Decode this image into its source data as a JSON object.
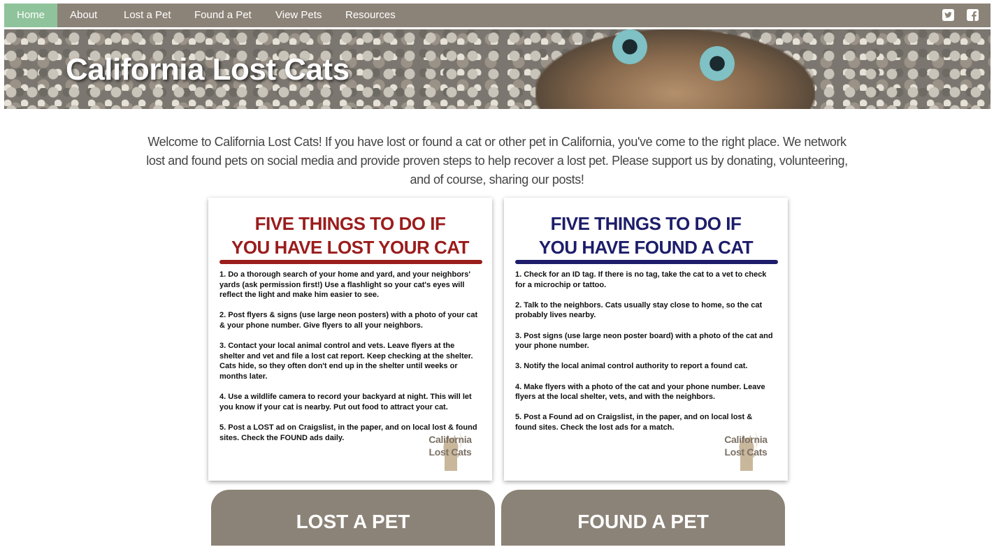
{
  "nav": {
    "items": [
      {
        "label": "Home",
        "active": true
      },
      {
        "label": "About"
      },
      {
        "label": "Lost a Pet"
      },
      {
        "label": "Found a Pet"
      },
      {
        "label": "View Pets"
      },
      {
        "label": "Resources"
      }
    ],
    "icons": [
      "twitter-icon",
      "facebook-icon"
    ]
  },
  "hero": {
    "title": "California Lost Cats"
  },
  "intro": "Welcome to California Lost Cats! If you have lost or found a cat or other pet in California, you've come to the right place. We network lost and found pets on social media and provide proven steps to help recover a lost pet. Please support us by donating, volunteering, and of course, sharing our posts!",
  "cards": [
    {
      "heading1": "FIVE THINGS TO DO IF",
      "heading2": "YOU HAVE LOST YOUR CAT",
      "color": "#9b1c1c",
      "items": [
        "1. Do a thorough search of your home and yard, and your neighbors' yards (ask permission first!) Use a flashlight so your cat's eyes will reflect the light and make him easier to see.",
        "2. Post flyers & signs (use large neon posters) with a photo of your cat & your phone number. Give flyers to all your neighbors.",
        "3. Contact your local animal control and vets. Leave flyers at the shelter and vet and file a lost cat report. Keep checking at the shelter. Cats hide, so they often don't end up in the shelter until weeks or months later.",
        "4. Use a wildlife camera to record your backyard at night. This will let you know if your cat is nearby. Put out food to attract your cat.",
        "5. Post a LOST ad on Craigslist, in the paper, and on local lost & found sites. Check the FOUND ads daily."
      ]
    },
    {
      "heading1": "FIVE THINGS TO DO IF",
      "heading2": "YOU HAVE FOUND A CAT",
      "color": "#1d1d6b",
      "items": [
        "1. Check for an ID tag. If there is no tag, take the cat to a vet to check for a microchip or tattoo.",
        "2. Talk to the neighbors. Cats usually stay close to home, so the cat probably lives nearby.",
        "3. Post signs (use large neon poster board) with a photo of the cat and your phone number.",
        "3. Notify the local animal control authority to report a found cat.",
        "4. Make flyers with a photo of the cat and your phone number. Leave flyers at the local shelter, vets, and with the neighbors.",
        "5. Post a Found ad on Craigslist, in the paper, and on local lost & found sites. Check the lost ads for a match."
      ]
    }
  ],
  "brand": {
    "line1": "California",
    "line2": "Lost Cats"
  },
  "buttons": {
    "lost": "LOST A PET",
    "found": "FOUND A PET"
  },
  "colors": {
    "nav": "#8c8378",
    "active": "#8fc39b",
    "lost_accent": "#9b1c1c",
    "found_accent": "#1d1d6b"
  }
}
